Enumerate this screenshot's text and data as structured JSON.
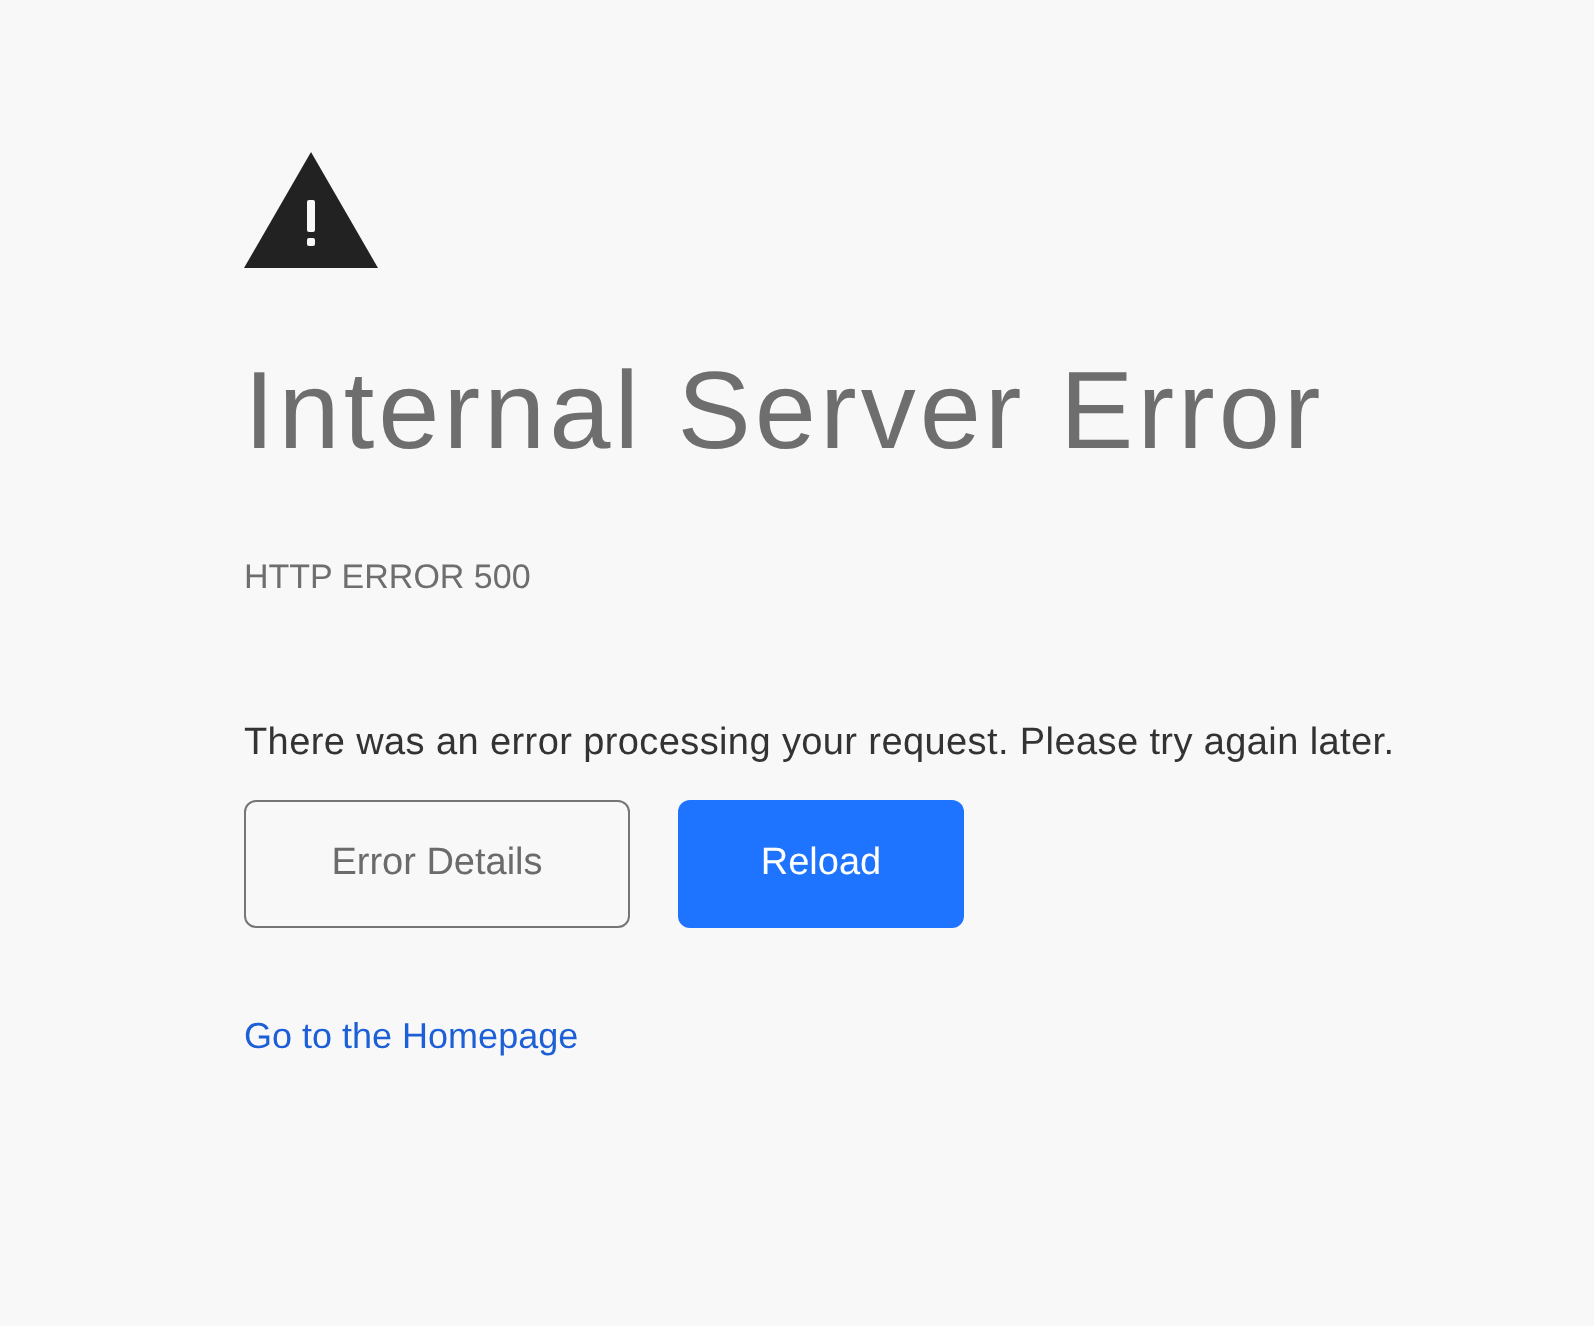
{
  "title": "Internal Server Error",
  "error_code": "HTTP ERROR 500",
  "message": "There was an error processing your request. Please try again later.",
  "buttons": [
    {
      "label": "Error Details",
      "kind": "secondary"
    },
    {
      "label": "Reload",
      "kind": "primary"
    }
  ],
  "link": "Go to the Homepage"
}
